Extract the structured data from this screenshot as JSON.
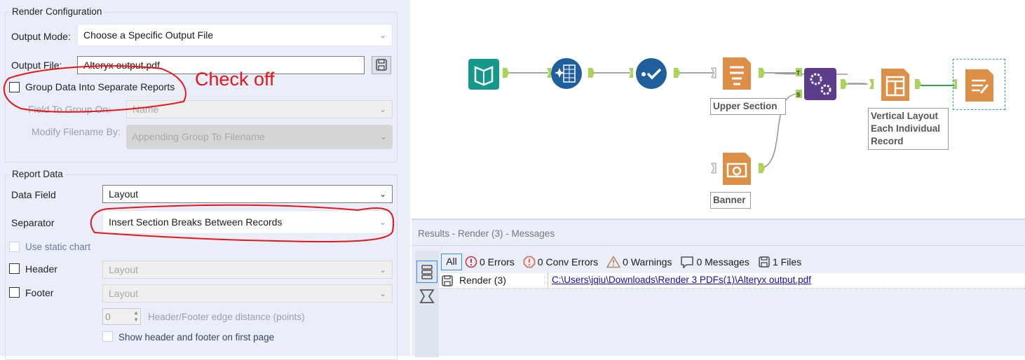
{
  "render_configuration": {
    "title": "Render Configuration",
    "output_mode_label": "Output Mode:",
    "output_mode_value": "Choose a Specific Output File",
    "output_file_label": "Output File:",
    "output_file_value": "Alteryx output.pdf",
    "group_data_label": "Group Data Into Separate Reports",
    "group_data_checked": false,
    "field_to_group_label": "Field To Group On:",
    "field_to_group_value": "Name",
    "modify_filename_label": "Modify Filename By:",
    "modify_filename_value": "Appending Group To Filename"
  },
  "report_data": {
    "title": "Report Data",
    "data_field_label": "Data Field",
    "data_field_value": "Layout",
    "separator_label": "Separator",
    "separator_value": "Insert Section Breaks Between Records",
    "static_chart_label": "Use static chart",
    "header_label": "Header",
    "header_value": "Layout",
    "footer_label": "Footer",
    "footer_value": "Layout",
    "edge_distance_value": "0",
    "edge_distance_label": "Header/Footer edge distance (points)",
    "show_first_page_label": "Show header and footer on first page"
  },
  "annotation": {
    "text": "Check off",
    "color": "#e8141b"
  },
  "canvas": {
    "notes": {
      "upper_section": "Upper Section",
      "vertical_layout": [
        "Vertical Layout",
        "Each Individual",
        "Record"
      ],
      "banner": "Banner"
    },
    "anchor_labels": {
      "table": "T",
      "section": "S"
    },
    "colors": {
      "teal": "#16998a",
      "blue": "#1f5f9b",
      "orange": "#dd8f48",
      "purple": "#5c3d8c",
      "connector": "#a8d45a"
    }
  },
  "results": {
    "title": "Results - Render (3) - Messages",
    "filters": {
      "all": "All",
      "errors": "0 Errors",
      "conv_errors": "0 Conv Errors",
      "warnings": "0 Warnings",
      "messages": "0 Messages",
      "files": "1 Files"
    },
    "rows": [
      {
        "tool": "Render (3)",
        "message": "C:\\Users\\jqiu\\Downloads\\Render 3 PDFs(1)\\Alteryx output.pdf"
      }
    ]
  }
}
